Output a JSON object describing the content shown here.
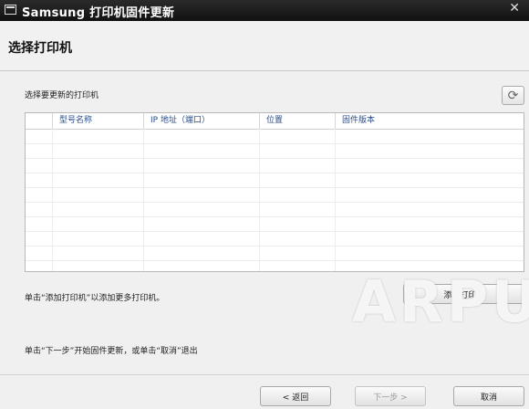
{
  "window": {
    "title": "Samsung 打印机固件更新",
    "icon": "window-icon",
    "close_symbol": "✕"
  },
  "header": {
    "title": "选择打印机"
  },
  "content": {
    "select_label": "选择要更新的打印机",
    "refresh_icon": "refresh-icon",
    "table": {
      "columns": [
        "",
        "型号名称",
        "IP 地址（端口）",
        "位置",
        "固件版本"
      ],
      "rows": []
    },
    "add_hint": "单击“添加打印机”以添加更多打印机。",
    "add_button_label": "添加打印机",
    "next_hint": "单击“下一步”开始固件更新，或单击“取消”退出"
  },
  "footer": {
    "back_label": "< 返回",
    "next_label": "下一步 >",
    "cancel_label": "取消"
  },
  "watermark": "ARPUN"
}
